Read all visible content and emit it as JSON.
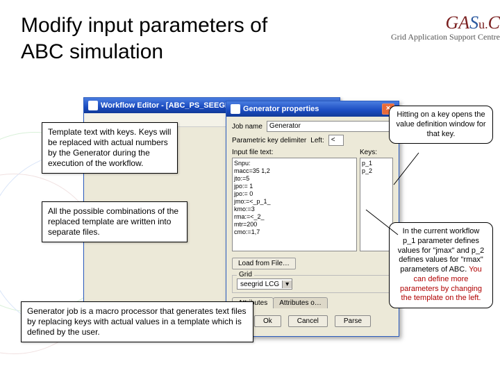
{
  "title": "Modify input parameters of ABC simulation",
  "brand": {
    "sub": "Grid Application Support Centre"
  },
  "win_back": {
    "title": "Workflow Editor - [ABC_PS_SEEGRID_…_Node_Edit…"
  },
  "win_front": {
    "title": "Generator properties",
    "job_label": "Job name",
    "job_value": "Generator",
    "delim_label": "Parametric key delimiter",
    "delim_left_label": "Left:",
    "delim_left_value": "<",
    "input_label": "Input file text:",
    "keys_label": "Keys:",
    "template_lines": [
      "Snpu:",
      "macc=35 1,2",
      "jto:=5",
      "jpo:= 1",
      "jpo:= 0",
      "jmo:=<_p_1_",
      "kmo:=3",
      "rma:=<_2_",
      "mtr=200",
      "cmo:=1,7"
    ],
    "keys_list": [
      "p_1",
      "p_2"
    ],
    "load_btn": "Load from File…",
    "grid_legend": "Grid",
    "grid_value": "seegrid LCG",
    "tab1": "Attributes",
    "tab2": "Attributes o…",
    "ok": "Ok",
    "cancel": "Cancel",
    "parse": "Parse"
  },
  "notes": {
    "n1": "Template text with keys. Keys will be replaced with actual numbers by the Generator during the execution of the workflow.",
    "n2": "All the possible combinations of the replaced template are written into separate files.",
    "n3": "Generator job is a macro processor that generates text files by replacing keys with actual values in a template which is defined by the user.",
    "c1": "Hitting on a key opens the value definition window for that key.",
    "c2a": "In the current workflow p_1 parameter defines values for \"jmax\" and p_2 defines values for \"rmax\" parameters of ABC. ",
    "c2b": "You can define more parameters by changing the template on the left."
  }
}
